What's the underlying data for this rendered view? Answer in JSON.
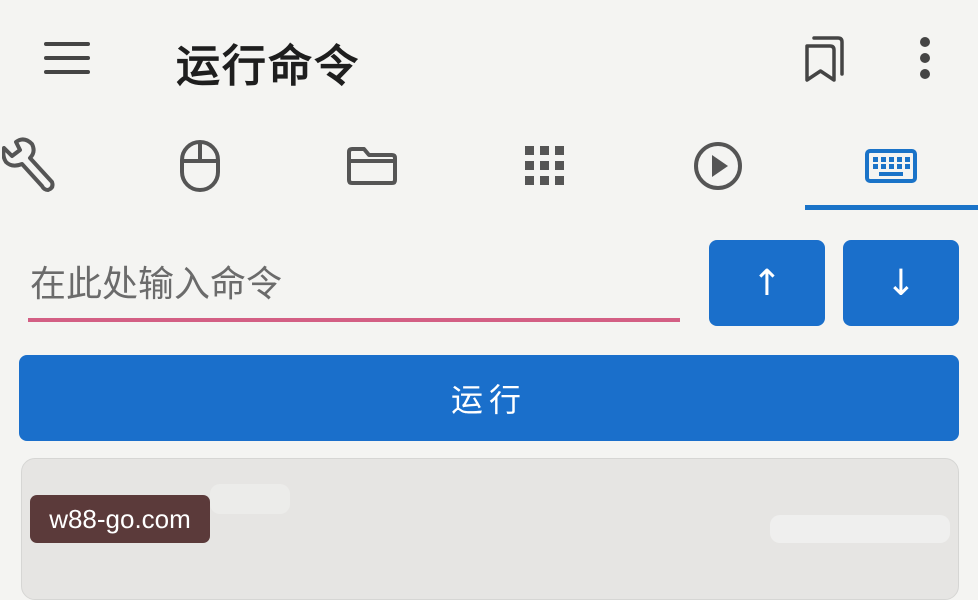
{
  "appbar": {
    "title": "运行命令",
    "menu_icon": "menu-icon",
    "bookmark_icon": "bookmarks-icon",
    "more_icon": "more-vert-icon"
  },
  "tabs": [
    {
      "icon": "wrench-icon",
      "selected": false
    },
    {
      "icon": "mouse-icon",
      "selected": false
    },
    {
      "icon": "folder-icon",
      "selected": false
    },
    {
      "icon": "apps-grid-icon",
      "selected": false
    },
    {
      "icon": "play-circle-icon",
      "selected": false
    },
    {
      "icon": "keyboard-icon",
      "selected": true
    }
  ],
  "command": {
    "value": "",
    "placeholder": "在此处输入命令"
  },
  "history": {
    "up_label": "↑",
    "down_label": "↓"
  },
  "run_button": {
    "label": "运行"
  },
  "watermark": {
    "text": "w88-go.com"
  },
  "colors": {
    "accent": "#1a6fcb",
    "input_underline": "#d35f84",
    "background": "#f4f4f2",
    "icon_grey": "#555555"
  }
}
